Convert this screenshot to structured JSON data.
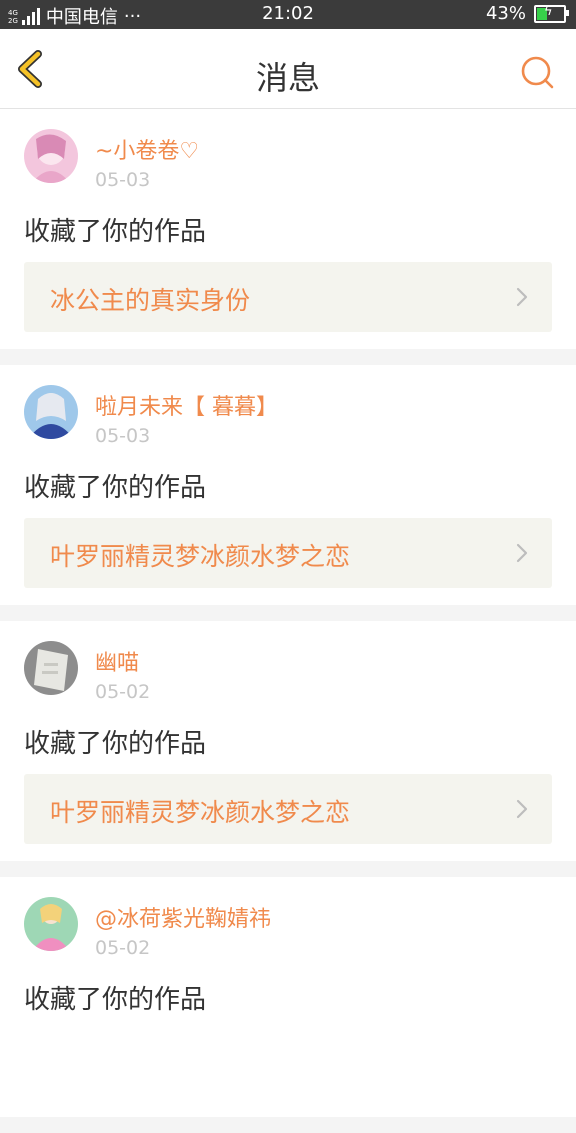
{
  "status_bar": {
    "network_top": "4G",
    "network_bottom": "2G",
    "carrier": "中国电信",
    "more": "···",
    "time": "21:02",
    "battery": "43%",
    "battery_level": 0.43,
    "battery_color": "#37d04a"
  },
  "header": {
    "title": "消息"
  },
  "colors": {
    "accent": "#f08a4c",
    "back_icon": "#f5c228"
  },
  "messages": [
    {
      "username": "~小卷卷♡",
      "date": "05-03",
      "action": "收藏了你的作品",
      "work_title": "冰公主的真实身份"
    },
    {
      "username": "啦月未来【 暮暮】",
      "date": "05-03",
      "action": "收藏了你的作品",
      "work_title": "叶罗丽精灵梦冰颜水梦之恋"
    },
    {
      "username": "幽喵",
      "date": "05-02",
      "action": "收藏了你的作品",
      "work_title": "叶罗丽精灵梦冰颜水梦之恋"
    },
    {
      "username": "@冰荷紫光鞠婧祎",
      "date": "05-02",
      "action": "收藏了你的作品",
      "work_title": ""
    }
  ]
}
